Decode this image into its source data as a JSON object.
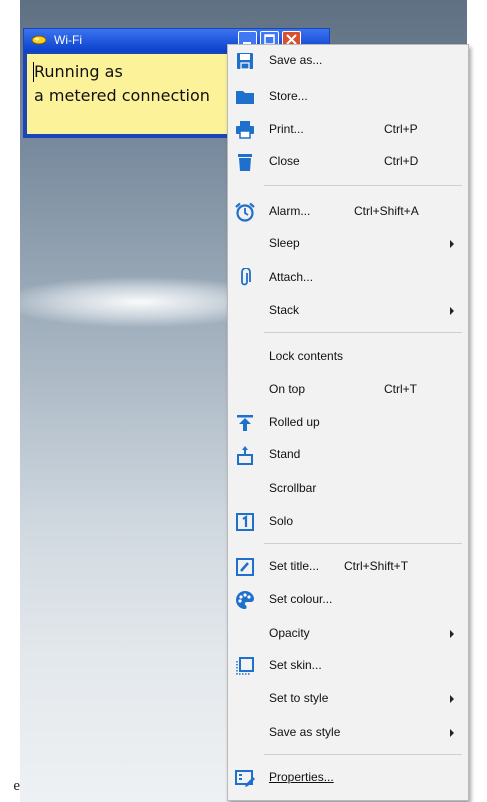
{
  "note": {
    "title": "Wi-Fi",
    "line1": "Running as",
    "line2": "a metered connection"
  },
  "edge_text": "e",
  "menu": {
    "items": [
      {
        "label": "Save as...",
        "shortcut": "",
        "icon": "save-icon"
      },
      {
        "label": "Store...",
        "shortcut": "",
        "icon": "folder-icon"
      },
      {
        "label": "Print...",
        "shortcut": "Ctrl+P",
        "icon": "print-icon"
      },
      {
        "label": "Close",
        "shortcut": "Ctrl+D",
        "icon": "trash-icon"
      },
      {
        "label": "Alarm...",
        "shortcut": "Ctrl+Shift+A",
        "icon": "alarm-clock-icon"
      },
      {
        "label": "Sleep",
        "shortcut": "",
        "icon": ""
      },
      {
        "label": "Attach...",
        "shortcut": "",
        "icon": "paperclip-icon"
      },
      {
        "label": "Stack",
        "shortcut": "",
        "icon": ""
      },
      {
        "label": "Lock contents",
        "shortcut": "",
        "icon": ""
      },
      {
        "label": "On top",
        "shortcut": "Ctrl+T",
        "icon": ""
      },
      {
        "label": "Rolled up",
        "shortcut": "",
        "icon": "roll-up-icon"
      },
      {
        "label": "Stand",
        "shortcut": "",
        "icon": "stand-icon"
      },
      {
        "label": "Scrollbar",
        "shortcut": "",
        "icon": ""
      },
      {
        "label": "Solo",
        "shortcut": "",
        "icon": "solo-icon"
      },
      {
        "label": "Set title...",
        "shortcut": "Ctrl+Shift+T",
        "icon": "pencil-icon"
      },
      {
        "label": "Set colour...",
        "shortcut": "",
        "icon": "palette-icon"
      },
      {
        "label": "Opacity",
        "shortcut": "",
        "icon": ""
      },
      {
        "label": "Set skin...",
        "shortcut": "",
        "icon": "skin-icon"
      },
      {
        "label": "Set to style",
        "shortcut": "",
        "icon": ""
      },
      {
        "label": "Save as style",
        "shortcut": "",
        "icon": ""
      },
      {
        "label": "Properties...",
        "shortcut": "",
        "icon": "properties-icon"
      }
    ]
  },
  "colors": {
    "accent": "#1b46b8",
    "icon_blue": "#1f6fcc",
    "note_yellow": "#fbf29a",
    "close_red": "#d9502f"
  }
}
